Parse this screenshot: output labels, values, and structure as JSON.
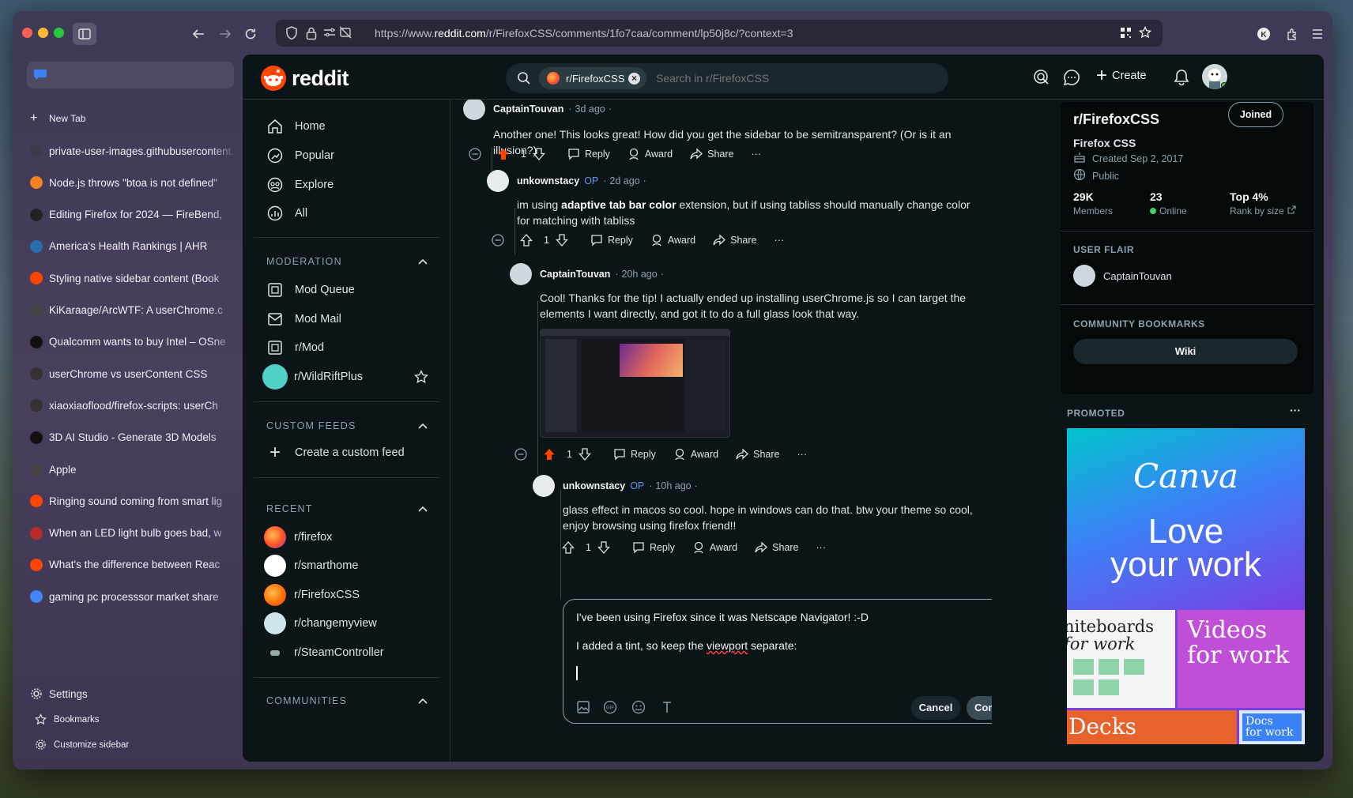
{
  "browser": {
    "url_prefix": "https://www.",
    "url_domain": "reddit.com",
    "url_path": "/r/FirefoxCSS/comments/1fo7caa/comment/lp50j8c/?context=3",
    "new_tab": "New Tab",
    "tabs": [
      {
        "title": "private-user-images.githubusercontent.",
        "color": "#3a3a4a"
      },
      {
        "title": "Node.js throws \"btoa is not defined\"",
        "color": "#f48024"
      },
      {
        "title": "Editing Firefox for 2024 — FireBend,",
        "color": "#222222"
      },
      {
        "title": "America's Health Rankings | AHR",
        "color": "#2b6cb0"
      },
      {
        "title": "Styling native sidebar content (Book",
        "color": "#ff4500"
      },
      {
        "title": "KiKaraage/ArcWTF: A userChrome.c",
        "color": "#444444"
      },
      {
        "title": "Qualcomm wants to buy Intel – OSne",
        "color": "#111111"
      },
      {
        "title": "userChrome vs userContent CSS",
        "color": "#333333"
      },
      {
        "title": "xiaoxiaoflood/firefox-scripts: userCh",
        "color": "#333333"
      },
      {
        "title": "3D AI Studio - Generate 3D Models",
        "color": "#111111"
      },
      {
        "title": "Apple",
        "color": "#444444"
      },
      {
        "title": "Ringing sound coming from smart lig",
        "color": "#ff4500"
      },
      {
        "title": "When an LED light bulb goes bad, w",
        "color": "#b92b27"
      },
      {
        "title": "What's the difference between Reac",
        "color": "#ff4500"
      },
      {
        "title": "gaming pc processsor market share",
        "color": "#4285f4"
      }
    ],
    "settings": "Settings",
    "bookmarks": "Bookmarks",
    "customize": "Customize sidebar"
  },
  "reddit": {
    "logo": "reddit",
    "chip": "r/FirefoxCSS",
    "search_placeholder": "Search in r/FirefoxCSS",
    "create": "Create",
    "nav": {
      "home": "Home",
      "popular": "Popular",
      "explore": "Explore",
      "all": "All"
    },
    "moderation": {
      "header": "MODERATION",
      "items": [
        "Mod Queue",
        "Mod Mail",
        "r/Mod",
        "r/WildRiftPlus"
      ]
    },
    "custom_feeds": {
      "header": "CUSTOM FEEDS",
      "create": "Create a custom feed"
    },
    "recent": {
      "header": "RECENT",
      "items": [
        "r/firefox",
        "r/smarthome",
        "r/FirefoxCSS",
        "r/changemyview",
        "r/SteamController"
      ]
    },
    "communities_header": "COMMUNITIES"
  },
  "comments": [
    {
      "user": "CaptainTouvan",
      "time": "3d ago",
      "body": "Another one! This looks great! How did you get the sidebar to be semitransparent? (Or is it an illusion?)",
      "votes": "1"
    },
    {
      "user": "unkownstacy",
      "op": "OP",
      "time": "2d ago",
      "body_pre": "im using ",
      "body_bold": "adaptive tab bar color",
      "body_post": " extension, but if using tabliss should manually change color for matching with tabliss",
      "votes": "1"
    },
    {
      "user": "CaptainTouvan",
      "time": "20h ago",
      "body": "Cool! Thanks for the tip! I actually ended up installing userChrome.js so I can target the elements I want directly, and got it to do a full glass look that way.",
      "votes": "1"
    },
    {
      "user": "unkownstacy",
      "op": "OP",
      "time": "10h ago",
      "body": "glass effect in macos so cool. hope in windows can do that. btw your theme so cool, enjoy browsing using firefox friend!!",
      "votes": "1"
    }
  ],
  "actions": {
    "reply": "Reply",
    "award": "Award",
    "share": "Share",
    "more": "···"
  },
  "editor": {
    "line1": "I've been using Firefox since it was Netscape Navigator! :-D",
    "line2_pre": "I added a tint, so keep the ",
    "line2_word": "viewport",
    "line2_post": " separate:",
    "cancel": "Cancel",
    "comment": "Comment"
  },
  "subreddit": {
    "name": "r/FirefoxCSS",
    "joined": "Joined",
    "title": "Firefox CSS",
    "created": "Created Sep 2, 2017",
    "visibility": "Public",
    "members_n": "29K",
    "members_l": "Members",
    "online_n": "23",
    "online_l": "Online",
    "rank_n": "Top 4%",
    "rank_l": "Rank by size",
    "user_flair_h": "USER FLAIR",
    "flair_user": "CaptainTouvan",
    "bookmarks_h": "COMMUNITY BOOKMARKS",
    "wiki": "Wiki"
  },
  "promoted": {
    "label": "PROMOTED",
    "more": "···",
    "brand": "Canva",
    "headline1": "Love",
    "headline2": "your work",
    "tile1_a": "niteboards",
    "tile1_b": "for work",
    "tile2_a": "Videos",
    "tile2_b": "for work",
    "tile3": "Decks",
    "tile4_a": "Docs",
    "tile4_b": "for work"
  },
  "colors": {
    "reddit_orange": "#ff4500",
    "upvoted": "#ff4500",
    "accent_blue": "#6495ed",
    "online": "#46d160"
  }
}
